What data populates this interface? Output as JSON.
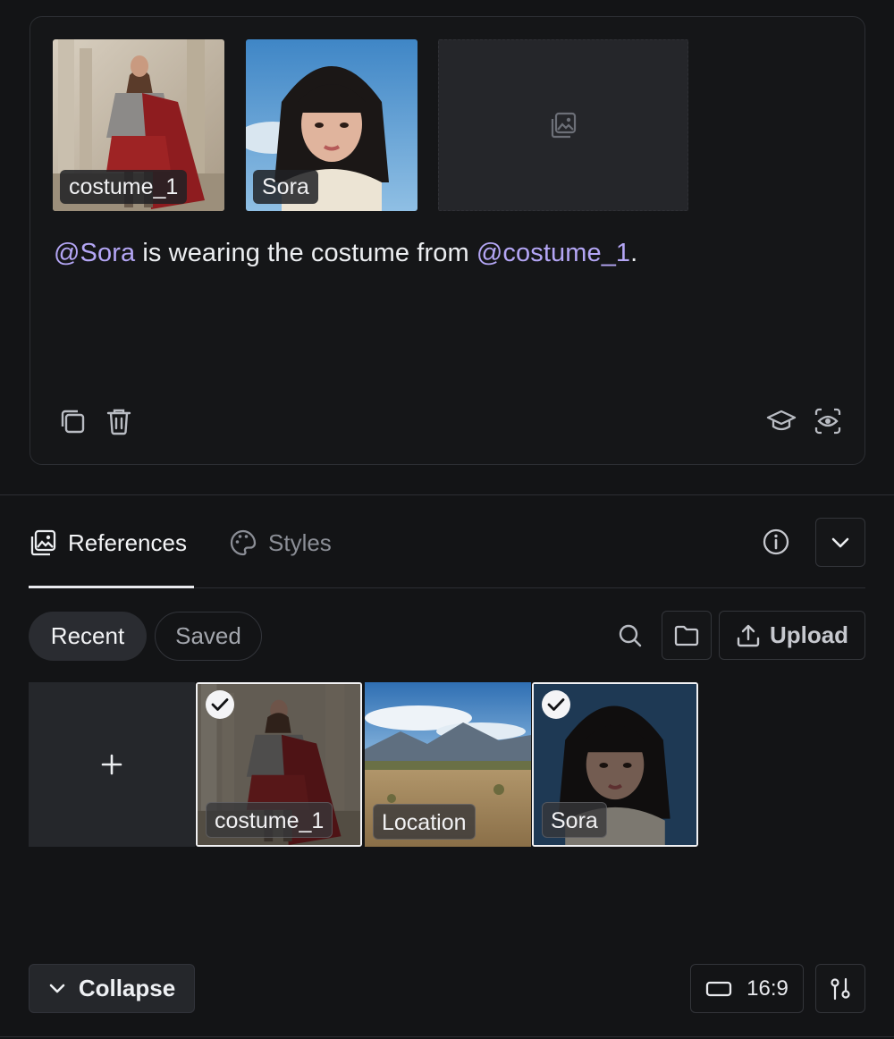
{
  "prompt": {
    "thumbnails": [
      {
        "label": "costume_1"
      },
      {
        "label": "Sora"
      }
    ],
    "empty_slot_icon": "image-placeholder-icon",
    "text_parts": {
      "mention_1": "@Sora",
      "middle": " is wearing the costume from ",
      "mention_2": "@costume_1",
      "end": "."
    },
    "actions_left": [
      "copy-icon",
      "trash-icon"
    ],
    "actions_right": [
      "graduation-cap-icon",
      "eye-scan-icon"
    ]
  },
  "tabs": [
    {
      "label": "References",
      "icon": "gallery-icon",
      "active": true
    },
    {
      "label": "Styles",
      "icon": "palette-icon",
      "active": false
    }
  ],
  "filters": [
    {
      "label": "Recent",
      "selected": true
    },
    {
      "label": "Saved",
      "selected": false
    }
  ],
  "toolbar": {
    "upload_label": "Upload"
  },
  "gallery": [
    {
      "label": "costume_1",
      "checked": true
    },
    {
      "label": "Location",
      "checked": false
    },
    {
      "label": "Sora",
      "checked": true
    }
  ],
  "footer": {
    "collapse_label": "Collapse",
    "aspect_ratio": "16:9"
  },
  "colors": {
    "background": "#131416",
    "mention": "#b4a6f5",
    "border": "#2c2e33"
  }
}
